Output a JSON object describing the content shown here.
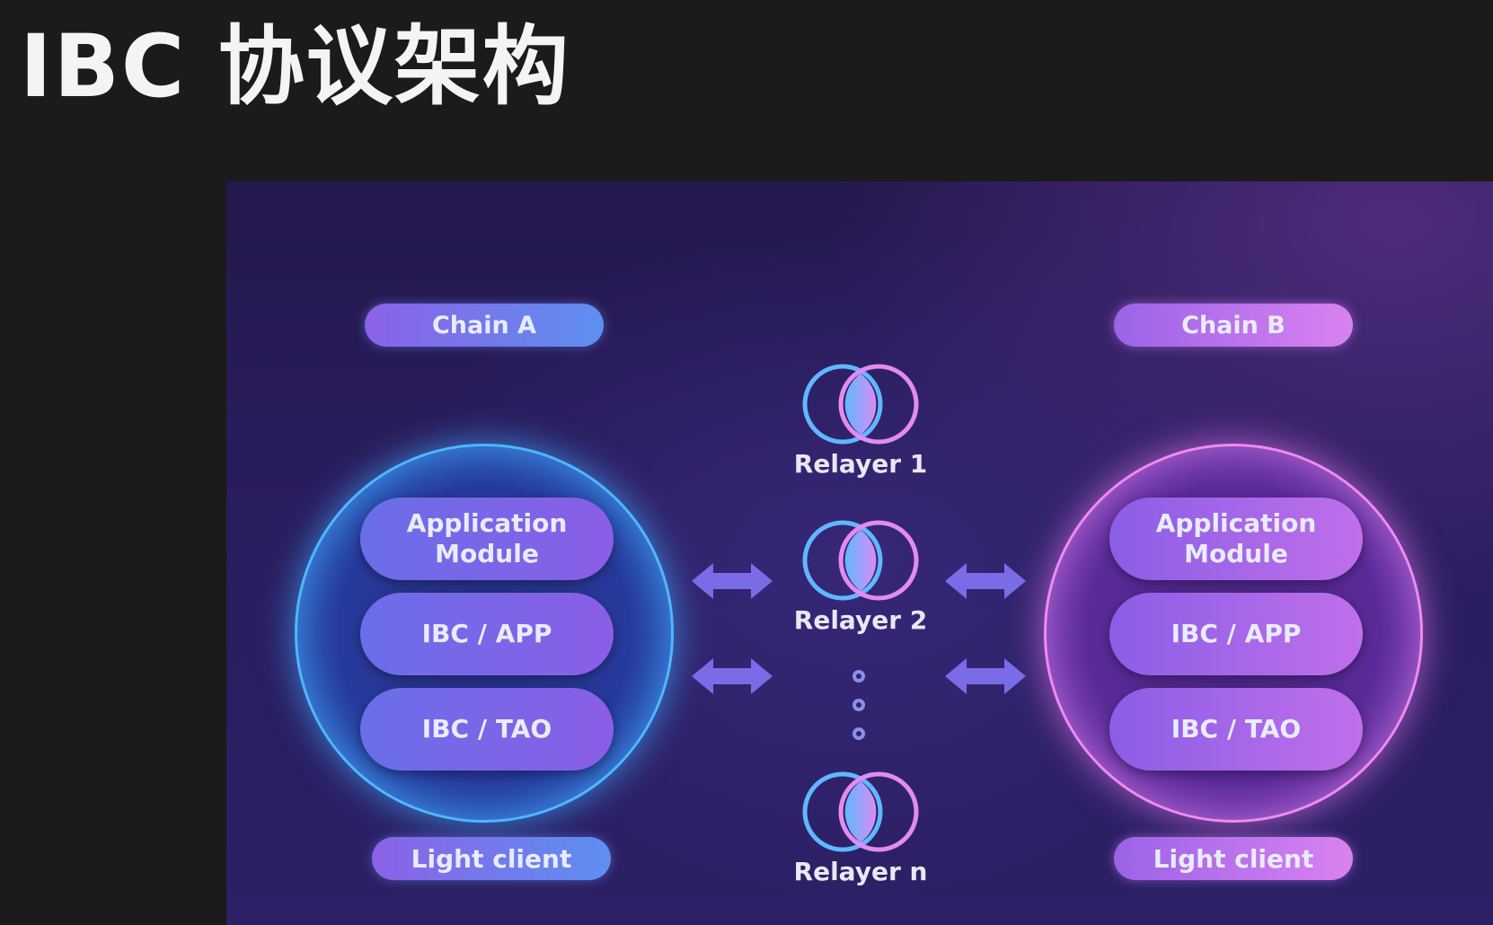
{
  "page": {
    "title": "IBC 协议架构"
  },
  "chain_a": {
    "label": "Chain A",
    "modules": [
      "Application\nModule",
      "IBC / APP",
      "IBC / TAO"
    ],
    "light_client": "Light client"
  },
  "chain_b": {
    "label": "Chain B",
    "modules": [
      "Application\nModule",
      "IBC / APP",
      "IBC / TAO"
    ],
    "light_client": "Light client"
  },
  "relayers": [
    "Relayer 1",
    "Relayer 2",
    "Relayer n"
  ],
  "colors": {
    "background": "#1b1b1c",
    "panel": "#2a1d5e",
    "chain_a_accent": "#4fb7ff",
    "chain_b_accent": "#f08bf0",
    "arrow": "#7a6be6"
  }
}
